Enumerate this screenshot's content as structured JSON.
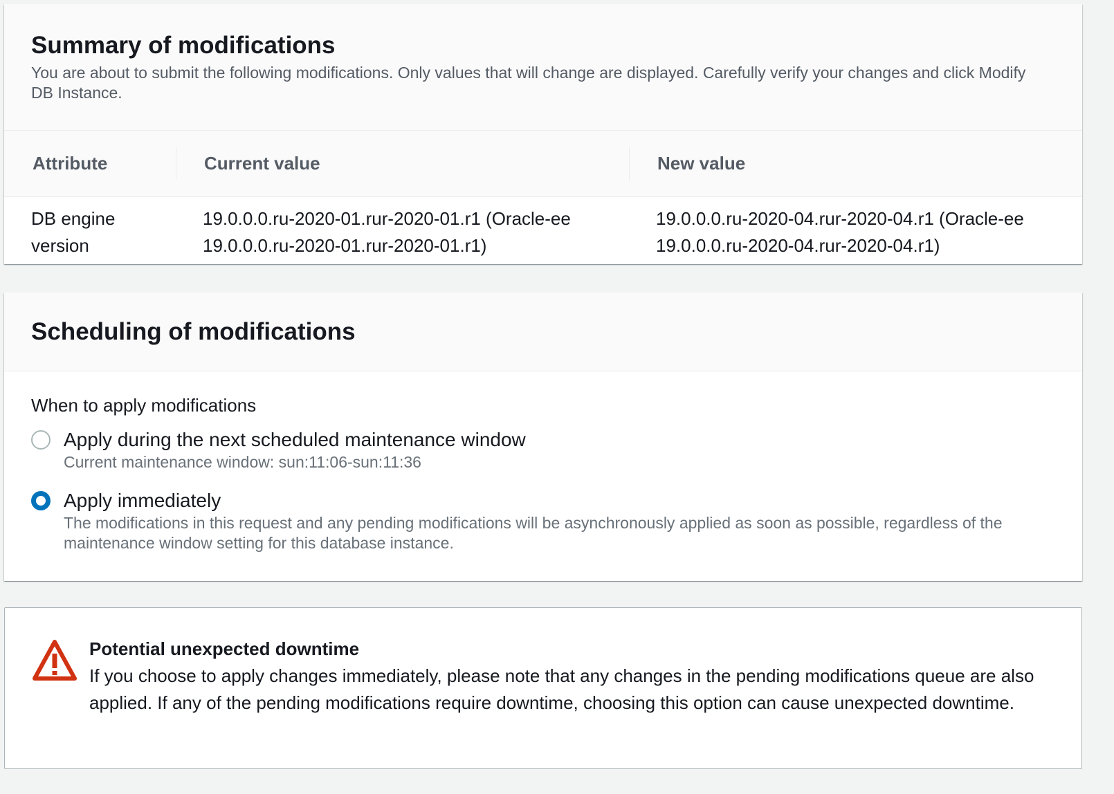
{
  "summary": {
    "title": "Summary of modifications",
    "description": "You are about to submit the following modifications. Only values that will change are displayed. Carefully verify your changes and click Modify DB Instance.",
    "columns": [
      "Attribute",
      "Current value",
      "New value"
    ],
    "rows": [
      {
        "attribute": "DB engine version",
        "current": "19.0.0.0.ru-2020-01.rur-2020-01.r1 (Oracle-ee 19.0.0.0.ru-2020-01.rur-2020-01.r1)",
        "new": "19.0.0.0.ru-2020-04.rur-2020-04.r1 (Oracle-ee 19.0.0.0.ru-2020-04.rur-2020-04.r1)"
      }
    ]
  },
  "scheduling": {
    "title": "Scheduling of modifications",
    "field_label": "When to apply modifications",
    "options": [
      {
        "label": "Apply during the next scheduled maintenance window",
        "description": "Current maintenance window: sun:11:06-sun:11:36",
        "selected": false
      },
      {
        "label": "Apply immediately",
        "description": "The modifications in this request and any pending modifications will be asynchronously applied as soon as possible, regardless of the maintenance window setting for this database instance.",
        "selected": true
      }
    ]
  },
  "warning": {
    "icon": "warning-triangle-icon",
    "title": "Potential unexpected downtime",
    "text": "If you choose to apply changes immediately, please note that any changes in the pending modifications queue are also applied. If any of the pending modifications require downtime, choosing this option can cause unexpected downtime."
  },
  "colors": {
    "accent": "#0073bb",
    "warning": "#d13212",
    "background": "#f2f3f3"
  }
}
